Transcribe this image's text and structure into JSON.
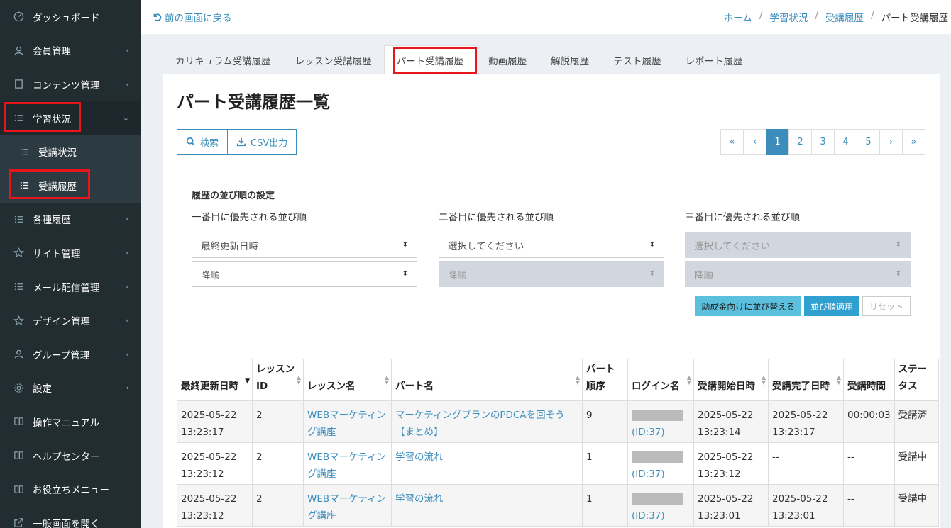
{
  "sidebar": {
    "items": [
      {
        "label": "ダッシュボード",
        "icon": "dashboard-icon",
        "chevron": ""
      },
      {
        "label": "会員管理",
        "icon": "users-icon",
        "chevron": "‹"
      },
      {
        "label": "コンテンツ管理",
        "icon": "file-icon",
        "chevron": "‹"
      },
      {
        "label": "学習状況",
        "icon": "list-icon",
        "chevron": "⌄"
      },
      {
        "label": "受講状況",
        "icon": "list-icon",
        "chevron": ""
      },
      {
        "label": "受講履歴",
        "icon": "list-icon",
        "chevron": ""
      },
      {
        "label": "各種履歴",
        "icon": "list-icon",
        "chevron": "‹"
      },
      {
        "label": "サイト管理",
        "icon": "star-icon",
        "chevron": "‹"
      },
      {
        "label": "メール配信管理",
        "icon": "list-icon",
        "chevron": "‹"
      },
      {
        "label": "デザイン管理",
        "icon": "star-icon",
        "chevron": "‹"
      },
      {
        "label": "グループ管理",
        "icon": "users-icon",
        "chevron": "‹"
      },
      {
        "label": "設定",
        "icon": "gear-icon",
        "chevron": "‹"
      },
      {
        "label": "操作マニュアル",
        "icon": "book-icon",
        "chevron": ""
      },
      {
        "label": "ヘルプセンター",
        "icon": "book-icon",
        "chevron": ""
      },
      {
        "label": "お役立ちメニュー",
        "icon": "book-icon",
        "chevron": ""
      },
      {
        "label": "一般画面を開く",
        "icon": "external-link-icon",
        "chevron": ""
      }
    ]
  },
  "topbar": {
    "back_label": "前の画面に戻る",
    "breadcrumb": [
      "ホーム",
      "学習状況",
      "受講履歴",
      "パート受講履歴"
    ]
  },
  "tabs": [
    "カリキュラム受講履歴",
    "レッスン受講履歴",
    "パート受講履歴",
    "動画履歴",
    "解説履歴",
    "テスト履歴",
    "レポート履歴"
  ],
  "page_title": "パート受講履歴一覧",
  "toolbar": {
    "search_label": "検索",
    "csv_label": "CSV出力"
  },
  "pagination": [
    "«",
    "‹",
    "1",
    "2",
    "3",
    "4",
    "5",
    "›",
    "»"
  ],
  "sort": {
    "title": "履歴の並び順の設定",
    "columns": [
      {
        "label": "一番目に優先される並び順",
        "field": "最終更新日時",
        "order": "降順"
      },
      {
        "label": "二番目に優先される並び順",
        "field": "選択してください",
        "order": "降順"
      },
      {
        "label": "三番目に優先される並び順",
        "field": "選択してください",
        "order": "降順"
      }
    ],
    "btn_subsidy": "助成金向けに並び替える",
    "btn_apply": "並び順適用",
    "btn_reset": "リセット"
  },
  "table": {
    "headers": [
      "最終更新日時",
      "レッスンID",
      "レッスン名",
      "パート名",
      "パート順序",
      "ログイン名",
      "受講開始日時",
      "受講完了日時",
      "受講時間",
      "ステータス"
    ],
    "rows": [
      {
        "updated": "2025-05-22 13:23:17",
        "lesson_id": "2",
        "lesson": "WEBマーケティング講座",
        "part": "マーケティングプランのPDCAを回そう【まとめ】",
        "order": "9",
        "login_suffix": "(ID:37)",
        "start": "2025-05-22 13:23:14",
        "end": "2025-05-22 13:23:17",
        "duration": "00:00:03",
        "status": "受講済"
      },
      {
        "updated": "2025-05-22 13:23:12",
        "lesson_id": "2",
        "lesson": "WEBマーケティング講座",
        "part": "学習の流れ",
        "order": "1",
        "login_suffix": "(ID:37)",
        "start": "2025-05-22 13:23:12",
        "end": "--",
        "duration": "--",
        "status": "受講中"
      },
      {
        "updated": "2025-05-22 13:23:12",
        "lesson_id": "2",
        "lesson": "WEBマーケティング講座",
        "part": "学習の流れ",
        "order": "1",
        "login_suffix": "(ID:37)",
        "start": "2025-05-22 13:23:01",
        "end": "2025-05-22 13:23:01",
        "duration": "--",
        "status": "受講中"
      }
    ]
  }
}
